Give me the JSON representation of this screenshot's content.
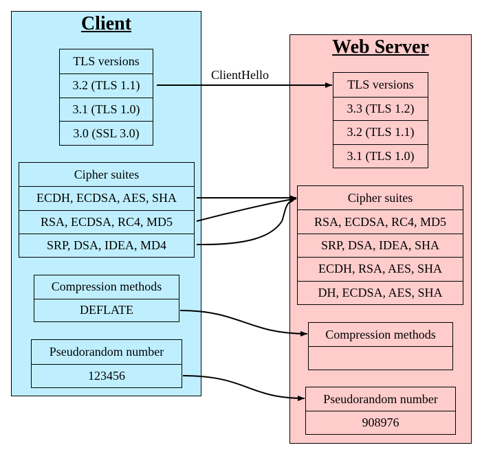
{
  "colors": {
    "client_fill": "#bfefff",
    "server_fill": "#ffcccc",
    "stroke": "#000000"
  },
  "client": {
    "title": "Client",
    "tls": {
      "header": "TLS versions",
      "rows": [
        "3.2 (TLS 1.1)",
        "3.1 (TLS 1.0)",
        "3.0 (SSL 3.0)"
      ]
    },
    "cipher": {
      "header": "Cipher suites",
      "rows": [
        "ECDH, ECDSA, AES, SHA",
        "RSA, ECDSA, RC4, MD5",
        "SRP, DSA, IDEA, MD4"
      ]
    },
    "compression": {
      "header": "Compression methods",
      "rows": [
        "DEFLATE"
      ]
    },
    "random": {
      "header": "Pseudorandom number",
      "rows": [
        "123456"
      ]
    }
  },
  "server": {
    "title": "Web Server",
    "tls": {
      "header": "TLS versions",
      "rows": [
        "3.3 (TLS 1.2)",
        "3.2 (TLS 1.1)",
        "3.1 (TLS 1.0)"
      ]
    },
    "cipher": {
      "header": "Cipher suites",
      "rows": [
        "RSA, ECDSA, RC4, MD5",
        "SRP, DSA, IDEA, SHA",
        "ECDH, RSA, AES, SHA",
        "DH, ECDSA, AES, SHA"
      ]
    },
    "compression": {
      "header": "Compression methods",
      "rows": [
        ""
      ]
    },
    "random": {
      "header": "Pseudorandom number",
      "rows": [
        "908976"
      ]
    }
  },
  "edges": {
    "client_hello_label": "ClientHello"
  }
}
